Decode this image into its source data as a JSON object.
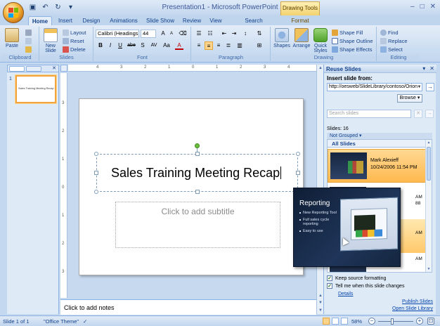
{
  "window": {
    "title": "Presentation1 - Microsoft PowerPoint",
    "context_tab_header": "Drawing Tools",
    "controls": [
      "–",
      "□",
      "✕"
    ]
  },
  "ribbon": {
    "tabs": [
      "Home",
      "Insert",
      "Design",
      "Animations",
      "Slide Show",
      "Review",
      "View",
      "Search Commands",
      "Format"
    ],
    "active_tab": "Home",
    "groups": {
      "clipboard": {
        "label": "Clipboard",
        "paste": "Paste"
      },
      "slides": {
        "label": "Slides",
        "new_slide": "New Slide",
        "layout": "Layout",
        "reset": "Reset",
        "delete": "Delete"
      },
      "font": {
        "label": "Font",
        "font_name": "Calibri (Headings)",
        "font_size": "44",
        "bold": "B",
        "italic": "I",
        "underline": "U",
        "strike": "abe",
        "shadow": "S",
        "spacing": "AV",
        "case": "Aa",
        "color": "A"
      },
      "paragraph": {
        "label": "Paragraph"
      },
      "drawing": {
        "label": "Drawing",
        "shapes": "Shapes",
        "arrange": "Arrange",
        "quick_styles": "Quick Styles",
        "shape_fill": "Shape Fill",
        "shape_outline": "Shape Outline",
        "shape_effects": "Shape Effects"
      },
      "editing": {
        "label": "Editing",
        "find": "Find",
        "replace": "Replace",
        "select": "Select"
      }
    }
  },
  "slides_pane": {
    "thumb_number": "1",
    "thumb_text": "Sales Training Meeting Recap"
  },
  "slide": {
    "title": "Sales Training Meeting Recap",
    "subtitle_placeholder": "Click to add subtitle"
  },
  "notes": {
    "placeholder": "Click to add notes"
  },
  "reuse_slides": {
    "title": "Reuse Slides",
    "insert_label": "Insert slide from:",
    "url": "http://oesweb/SlideLibrary/contoso/Orion",
    "browse": "Browse",
    "search_placeholder": "Search slides",
    "count": "Slides: 16",
    "grouping": "Not Grouped",
    "all_slides": "All Slides",
    "items": [
      {
        "author": "Mark Alexieff",
        "date": "10/24/2006 11:54 PM"
      },
      {
        "fragment_a": "AM",
        "fragment_b": "88"
      },
      {
        "fragment_a": "AM"
      },
      {
        "fragment_a": "AM"
      }
    ],
    "keep_source": "Keep source formatting",
    "tell_me": "Tell me when this slide changes",
    "details": "Details",
    "publish": "Publish Slides",
    "open_library": "Open Slide Library"
  },
  "preview": {
    "title": "Reporting",
    "bullets": [
      "New Reporting Tool",
      "Full sales cycle reporting",
      "Easy to use"
    ]
  },
  "status": {
    "slide_info": "Slide 1 of 1",
    "theme": "\"Office Theme\"",
    "zoom": "58%"
  },
  "colors": {
    "accent": "#15428b",
    "selection": "#ffb94f",
    "ribbon": "#c2d6ee"
  }
}
